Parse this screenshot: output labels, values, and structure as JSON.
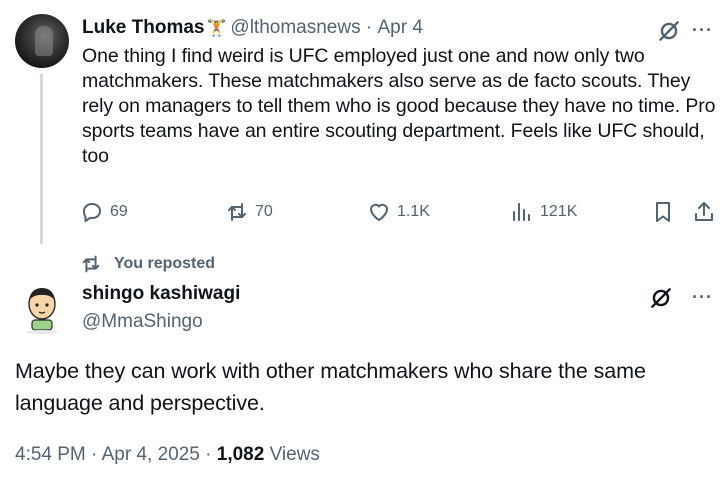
{
  "quoted_tweet": {
    "author_name": "Luke Thomas",
    "author_emoji": "🏋",
    "handle": "@lthomasnews",
    "date": "Apr 4",
    "text": "One thing I find weird is UFC employed just one and now only two matchmakers. These matchmakers also serve as de facto scouts. They rely on managers to tell them who is good because they have no time. Pro sports teams have an entire scouting department. Feels like UFC should, too",
    "actions": {
      "replies": "69",
      "reposts": "70",
      "likes": "1.1K",
      "views": "121K"
    }
  },
  "repost_indicator": {
    "label": "You reposted"
  },
  "main_tweet": {
    "author_name": "shingo kashiwagi",
    "handle": "@MmaShingo",
    "text": "Maybe they can work with other matchmakers who share the same language and perspective.",
    "time": "4:54 PM",
    "date": "Apr 4, 2025",
    "views_count": "1,082",
    "views_label": "Views"
  },
  "more_glyph": "···",
  "colors": {
    "text_primary": "#0f1419",
    "text_secondary": "#536471",
    "thread_line": "#cfd9de"
  },
  "icons": [
    "grok-icon",
    "more-icon",
    "reply-icon",
    "repost-icon",
    "like-icon",
    "views-icon",
    "bookmark-icon",
    "share-icon"
  ]
}
